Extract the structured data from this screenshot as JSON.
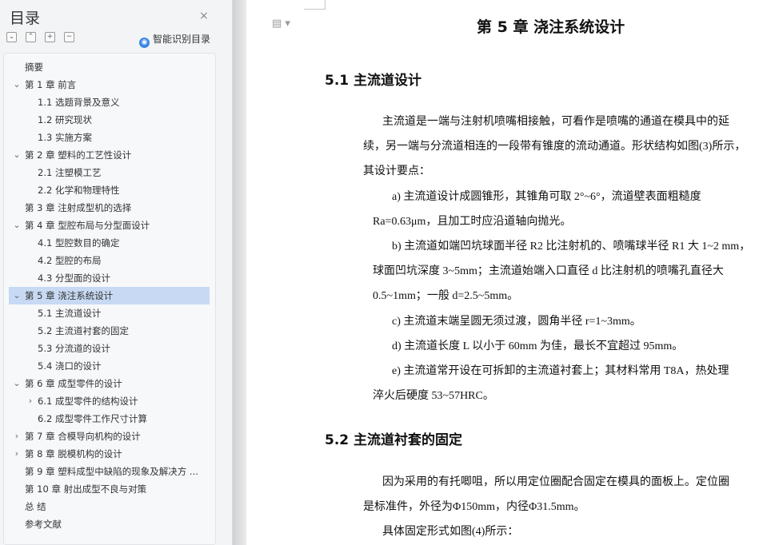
{
  "sidebar": {
    "title": "目录",
    "close": "×",
    "tools": [
      "⌄",
      "⌃",
      "+",
      "−"
    ],
    "smart_label": "智能识别目录",
    "items": [
      {
        "label": "摘要",
        "caret": ""
      },
      {
        "label": "第 1 章  前言",
        "caret": "⌄"
      },
      {
        "label": "1.1 选题背景及意义",
        "caret": ""
      },
      {
        "label": "1.2 研究现状",
        "caret": ""
      },
      {
        "label": "1.3 实施方案",
        "caret": ""
      },
      {
        "label": "第 2 章  塑料的工艺性设计",
        "caret": "⌄"
      },
      {
        "label": "2.1 注塑模工艺",
        "caret": ""
      },
      {
        "label": "2.2 化学和物理特性",
        "caret": ""
      },
      {
        "label": "第 3 章  注射成型机的选择",
        "caret": ""
      },
      {
        "label": "第 4 章  型腔布局与分型面设计",
        "caret": "⌄"
      },
      {
        "label": "4.1 型腔数目的确定",
        "caret": ""
      },
      {
        "label": "4.2 型腔的布局",
        "caret": ""
      },
      {
        "label": "4.3 分型面的设计",
        "caret": ""
      },
      {
        "label": "第 5 章  浇注系统设计",
        "caret": "⌄"
      },
      {
        "label": "5.1 主流道设计",
        "caret": ""
      },
      {
        "label": "5.2 主流道衬套的固定",
        "caret": ""
      },
      {
        "label": "5.3 分流道的设计",
        "caret": ""
      },
      {
        "label": "5.4 浇口的设计",
        "caret": ""
      },
      {
        "label": "第 6 章  成型零件的设计",
        "caret": "⌄"
      },
      {
        "label": "6.1 成型零件的结构设计",
        "caret": "›"
      },
      {
        "label": "6.2 成型零件工作尺寸计算",
        "caret": ""
      },
      {
        "label": "第 7 章  合模导向机构的设计",
        "caret": "›"
      },
      {
        "label": "第 8 章  脱模机构的设计",
        "caret": "›"
      },
      {
        "label": "第 9 章  塑料成型中缺陷的现象及解决方 ...",
        "caret": ""
      },
      {
        "label": "第 10 章  射出成型不良与对策",
        "caret": ""
      },
      {
        "label": "总    结",
        "caret": ""
      },
      {
        "label": "参考文献",
        "caret": ""
      }
    ]
  },
  "doc": {
    "chapter_title": "第 5 章  浇注系统设计",
    "sec1_title": "5.1 主流道设计",
    "sec1_paragraphs": [
      "主流道是一端与注射机喷嘴相接触，可看作是喷嘴的通道在模具中的延",
      "续，另一端与分流道相连的一段带有锥度的流动通道。形状结构如图(3)所示，",
      "其设计要点：",
      "a)   主流道设计成圆锥形，其锥角可取 2°~6°，流道壁表面粗糙度",
      "Ra=0.63μm，且加工时应沿道轴向抛光。",
      "b)   主流道如端凹坑球面半径 R2 比注射机的、喷嘴球半径 R1 大 1~2 mm，",
      "球面凹坑深度 3~5mm；主流道始端入口直径 d 比注射机的喷嘴孔直径大",
      "0.5~1mm；一般 d=2.5~5mm。",
      "c)   主流道末端呈圆无须过渡，圆角半径 r=1~3mm。",
      "d)   主流道长度 L 以小于 60mm 为佳，最长不宜超过 95mm。",
      "e)   主流道常开设在可拆卸的主流道衬套上；其材料常用 T8A，热处理",
      "淬火后硬度 53~57HRC。"
    ],
    "sec2_title": "5.2 主流道衬套的固定",
    "sec2_paragraphs": [
      "因为采用的有托唧咀，所以用定位圈配合固定在模具的面板上。定位圈",
      "是标准件，外径为Φ150mm，内径Φ31.5mm。",
      "具体固定形式如图(4)所示："
    ]
  }
}
